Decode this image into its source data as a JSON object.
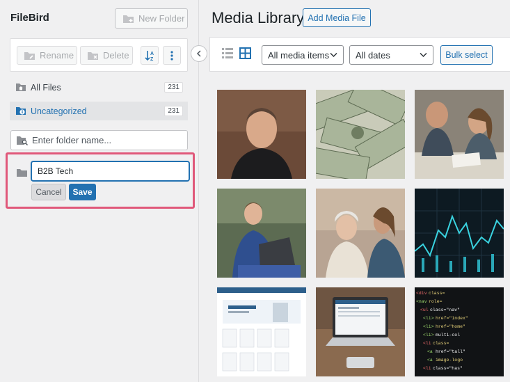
{
  "sidebar": {
    "title": "FileBird",
    "new_folder_label": "New Folder",
    "rename_label": "Rename",
    "delete_label": "Delete",
    "tree": [
      {
        "label": "All Files",
        "count": "231"
      },
      {
        "label": "Uncategorized",
        "count": "231"
      }
    ],
    "search_placeholder": "Enter folder name...",
    "edit": {
      "value": "B2B Tech",
      "cancel_label": "Cancel",
      "save_label": "Save"
    }
  },
  "main": {
    "title": "Media Library",
    "add_media_label": "Add Media File",
    "filter_media": "All media items",
    "filter_dates": "All dates",
    "bulk_label": "Bulk select",
    "media": [
      {
        "subject": "man portrait"
      },
      {
        "subject": "dollar bills"
      },
      {
        "subject": "couple with laptop"
      },
      {
        "subject": "man with laptop"
      },
      {
        "subject": "elderly women smiling"
      },
      {
        "subject": "stock chart"
      },
      {
        "subject": "website screenshot"
      },
      {
        "subject": "laptop on table"
      },
      {
        "subject": "html code"
      }
    ]
  },
  "colors": {
    "accent": "#2271b1",
    "highlight_border": "#e0587a",
    "background": "#f0f0f1"
  }
}
